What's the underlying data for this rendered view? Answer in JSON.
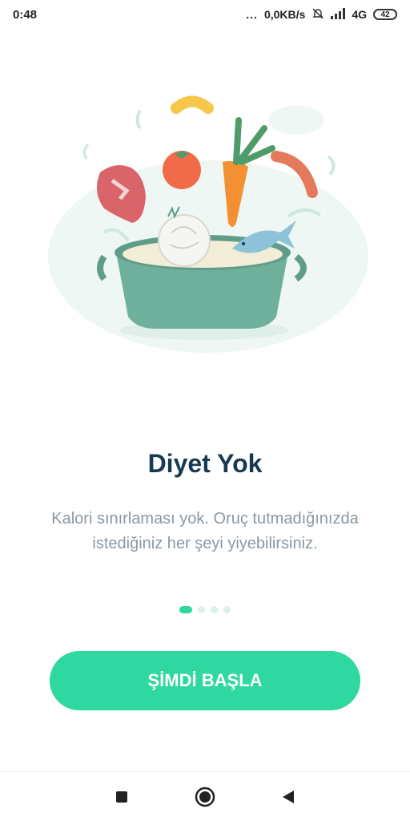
{
  "status": {
    "time": "0:48",
    "more": "...",
    "network_speed": "0,0KB/s",
    "network_type": "4G",
    "battery": "42"
  },
  "onboarding": {
    "title": "Diyet Yok",
    "description": "Kalori sınırlaması yok. Oruç tutmadığınızda istediğiniz her şeyi yiyebilirsiniz.",
    "page_index": 1,
    "page_count": 4,
    "start_button_label": "ŞİMDİ BAŞLA"
  },
  "colors": {
    "accent": "#2ed8a0",
    "title": "#173a52",
    "body_text": "#8a99a4"
  },
  "icons": [
    "mute-bell-icon",
    "signal-icon",
    "battery-icon",
    "cooking-pot-illustration",
    "recents-square-icon",
    "home-circle-icon",
    "back-triangle-icon"
  ]
}
